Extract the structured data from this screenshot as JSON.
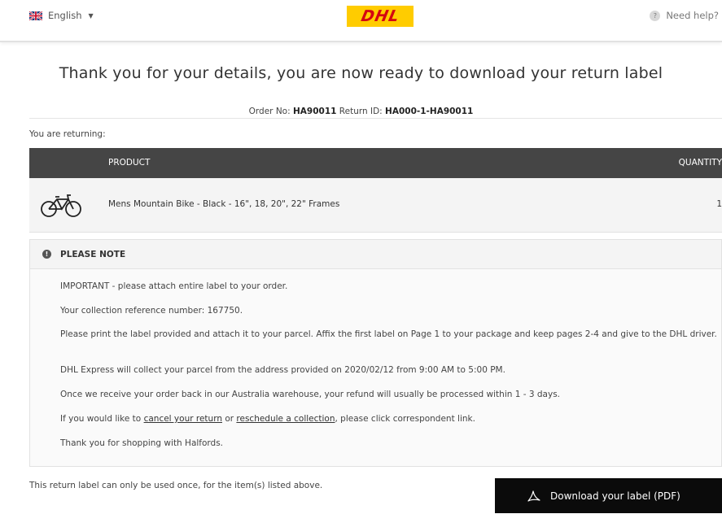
{
  "header": {
    "language": "English",
    "logo_text": "DHL",
    "help_text": "Need help?",
    "help_icon": "?"
  },
  "title": "Thank you for your details, you are now ready to download your return label",
  "order": {
    "order_no_label": "Order No:",
    "order_no": "HA90011",
    "return_id_label": "Return ID:",
    "return_id": "HA000-1-HA90011"
  },
  "returning_label": "You are returning:",
  "table": {
    "headers": {
      "product": "PRODUCT",
      "quantity": "QUANTITY"
    },
    "rows": [
      {
        "product": "Mens Mountain Bike - Black - 16\", 18, 20\", 22\" Frames",
        "quantity": "1",
        "icon": "bicycle-icon"
      }
    ]
  },
  "note": {
    "title": "PLEASE NOTE",
    "icon": "!",
    "lines": [
      "IMPORTANT - please attach entire label to your order.",
      "Your collection reference number: 167750.",
      "Please print the label provided and attach it to your parcel. Affix the first label on Page 1 to your package and keep pages 2-4 and give to the DHL driver.",
      "DHL Express will collect your parcel from the address provided on 2020/02/12 from 9:00 AM to 5:00 PM.",
      "Once we receive your order back in our Australia warehouse, your refund will usually be processed within 1 - 3 days."
    ],
    "links_line": {
      "prefix": "If you would like to ",
      "cancel_link": "cancel your return",
      "middle": " or ",
      "reschedule_link": "reschedule a collection",
      "suffix": ", please click correspondent link."
    },
    "thanks": "Thank you for shopping with Halfords."
  },
  "footer_note": "This return label can only be used once, for the item(s) listed above.",
  "download_button": "Download your label (PDF)",
  "colors": {
    "dhl_yellow": "#ffcc00",
    "dhl_red": "#d40511",
    "table_header": "#454545",
    "button": "#0b0b0b"
  }
}
